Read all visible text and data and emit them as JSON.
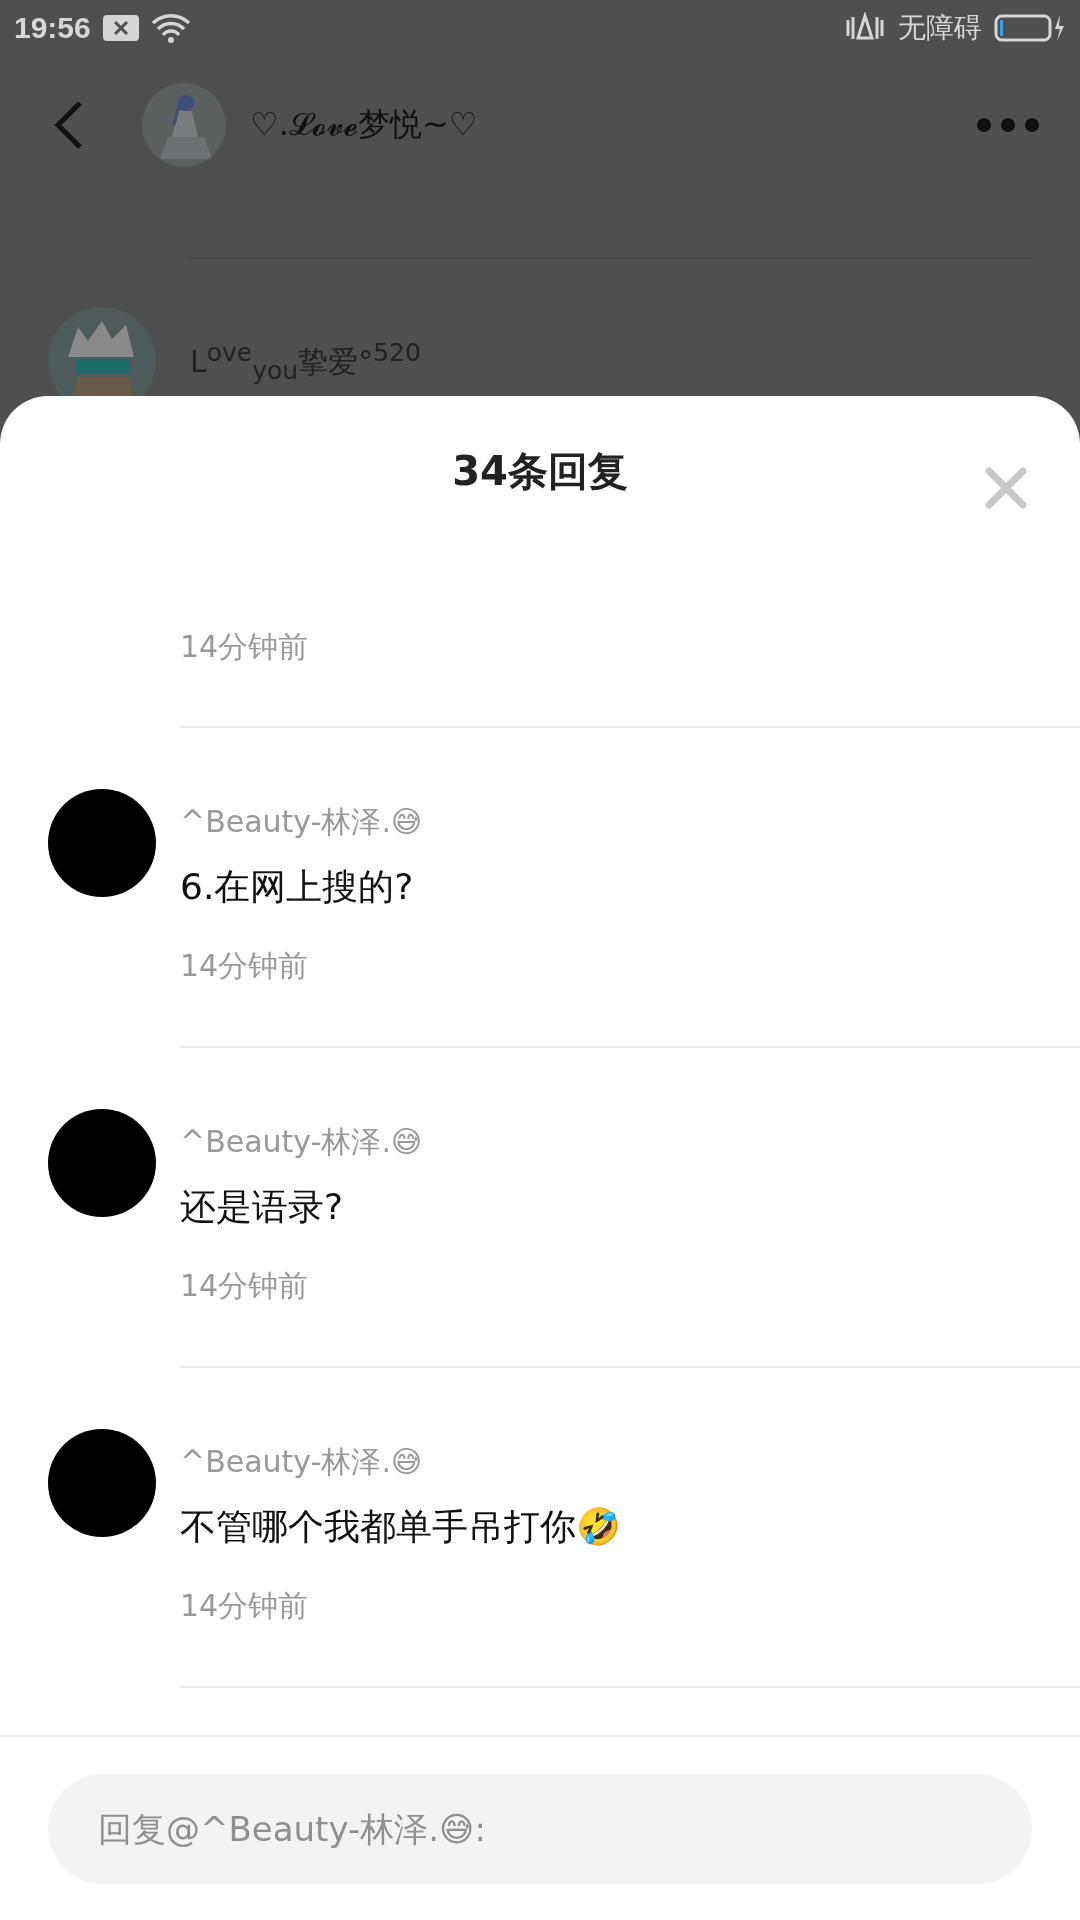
{
  "status_bar": {
    "time": "19:56",
    "accessibility": "无障碍"
  },
  "header": {
    "title": "♡.𝓛𝓸𝓿𝓮梦悦~♡"
  },
  "background_comment": {
    "author": "L$^{ove}$$_{you}$挚爱°$^{520}$"
  },
  "reply_sheet": {
    "title": "34条回复",
    "partial_reply": {
      "time": "14分钟前"
    },
    "replies": [
      {
        "author": "^Beauty-林泽.😅",
        "text": "6.在网上搜的?",
        "time": "14分钟前"
      },
      {
        "author": "^Beauty-林泽.😅",
        "text": "还是语录?",
        "time": "14分钟前"
      },
      {
        "author": "^Beauty-林泽.😅",
        "text": "不管哪个我都单手吊打你🤣",
        "time": "14分钟前"
      }
    ],
    "reply_input": {
      "placeholder": "回复@^Beauty-林泽.😅:"
    }
  }
}
